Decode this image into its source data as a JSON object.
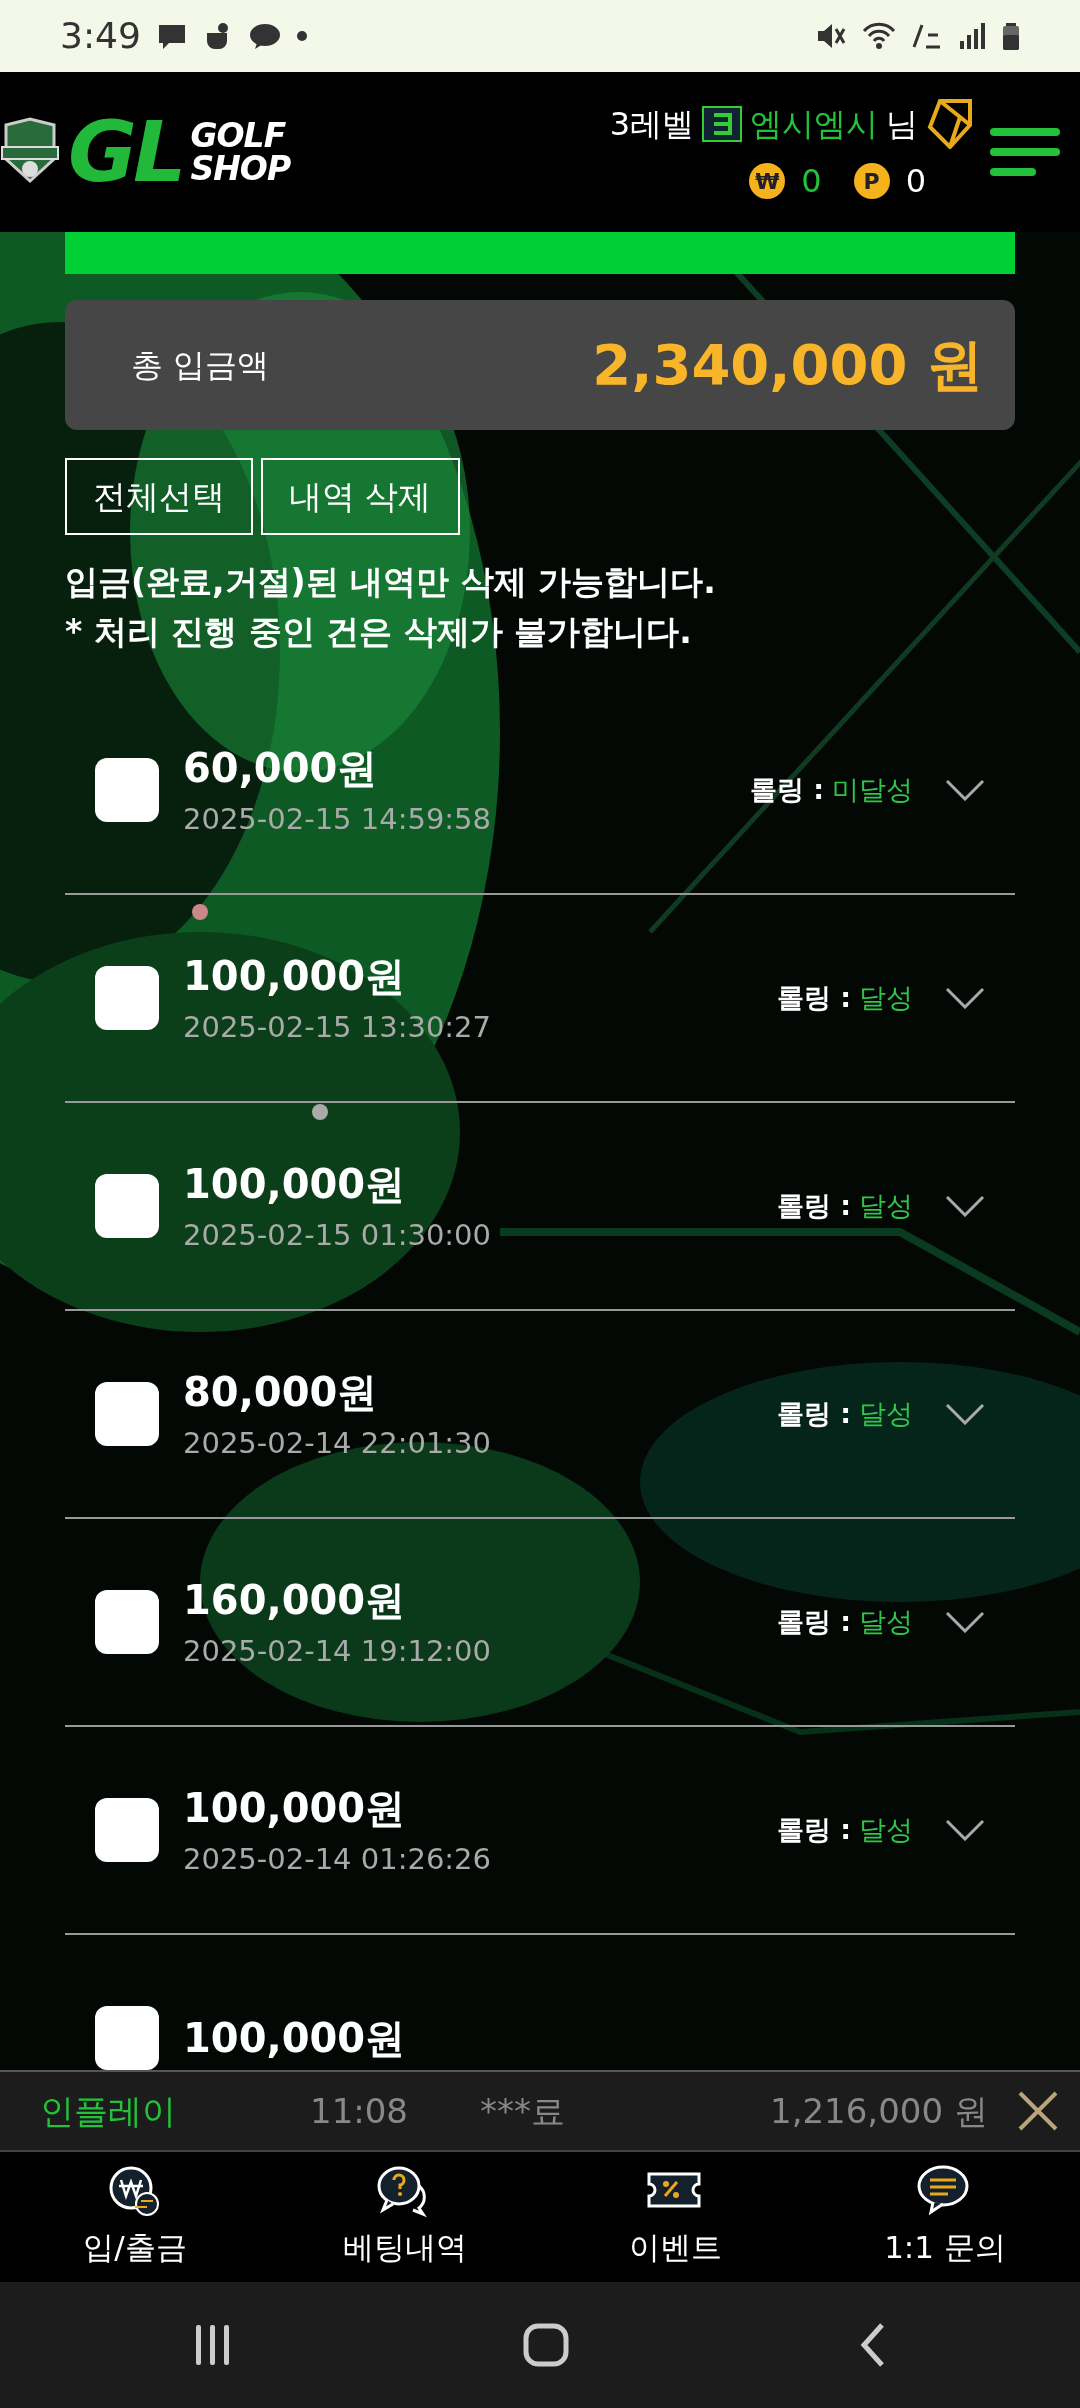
{
  "status_bar": {
    "time": "3:49"
  },
  "header": {
    "logo_text": "GL",
    "logo_subtitle": [
      "GOLF",
      "SHOP"
    ],
    "user": {
      "level": "3레벨",
      "nickname": "엠시엠시",
      "suffix": "님"
    },
    "balances": [
      {
        "symbol": "₩",
        "value": "0",
        "color": "#22c33a"
      },
      {
        "symbol": "P",
        "value": "0",
        "color": "#ffffff"
      }
    ]
  },
  "summary": {
    "label": "총 입금액",
    "amount": "2,340,000 원"
  },
  "actions": [
    "전체선택",
    "내역 삭제"
  ],
  "notes": [
    "입금(완료,거절)된 내역만 삭제 가능합니다.",
    "* 처리 진행 중인 건은 삭제가 불가합니다."
  ],
  "deposits": [
    {
      "amount": "60,000원",
      "date": "2025-02-15 14:59:58",
      "rolling_label": "롤링 :",
      "rolling_status": "미달성",
      "checked": false
    },
    {
      "amount": "100,000원",
      "date": "2025-02-15 13:30:27",
      "rolling_label": "롤링 :",
      "rolling_status": "달성",
      "checked": false
    },
    {
      "amount": "100,000원",
      "date": "2025-02-15 01:30:00",
      "rolling_label": "롤링 :",
      "rolling_status": "달성",
      "checked": false
    },
    {
      "amount": "80,000원",
      "date": "2025-02-14 22:01:30",
      "rolling_label": "롤링 :",
      "rolling_status": "달성",
      "checked": false
    },
    {
      "amount": "160,000원",
      "date": "2025-02-14 19:12:00",
      "rolling_label": "롤링 :",
      "rolling_status": "달성",
      "checked": false
    },
    {
      "amount": "100,000원",
      "date": "2025-02-14 01:26:26",
      "rolling_label": "롤링 :",
      "rolling_status": "달성",
      "checked": false
    },
    {
      "amount": "100,000원",
      "checked": false
    }
  ],
  "ticker": {
    "game": "인플레이",
    "time": "11:08",
    "user": "***료",
    "amount": "1,216,000 원"
  },
  "bottom_nav": [
    {
      "label": "입/출금",
      "kind": "exchange"
    },
    {
      "label": "베팅내역",
      "kind": "chat-question"
    },
    {
      "label": "이벤트",
      "kind": "ticket"
    },
    {
      "label": "1:1 문의",
      "kind": "message"
    }
  ]
}
